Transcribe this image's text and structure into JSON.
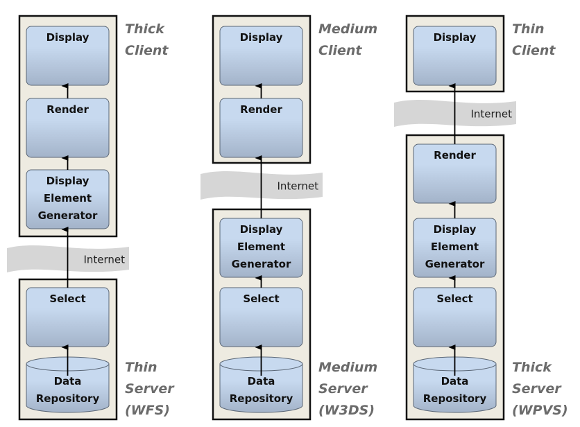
{
  "colors": {
    "tier_fill": "#eeebe1",
    "tier_stroke": "#111111",
    "component_top": "#c7d9ef",
    "component_bottom": "#a3b3c9",
    "network_band": "#d6d6d6",
    "label": "#6b6b6b"
  },
  "columns": [
    {
      "client_label": [
        "Thick",
        "Client"
      ],
      "server_label": [
        "Thin",
        "Server",
        "(WFS)"
      ],
      "client_components": [
        [
          "Display"
        ],
        [
          "Render"
        ],
        [
          "Display",
          "Element",
          "Generator"
        ]
      ],
      "server_components": [
        [
          "Select"
        ]
      ],
      "repository": [
        "Data",
        "Repository"
      ],
      "network_label": "Internet"
    },
    {
      "client_label": [
        "Medium",
        "Client"
      ],
      "server_label": [
        "Medium",
        "Server",
        "(W3DS)"
      ],
      "client_components": [
        [
          "Display"
        ],
        [
          "Render"
        ]
      ],
      "server_components": [
        [
          "Display",
          "Element",
          "Generator"
        ],
        [
          "Select"
        ]
      ],
      "repository": [
        "Data",
        "Repository"
      ],
      "network_label": "Internet"
    },
    {
      "client_label": [
        "Thin",
        "Client"
      ],
      "server_label": [
        "Thick",
        "Server",
        "(WPVS)"
      ],
      "client_components": [
        [
          "Display"
        ]
      ],
      "server_components": [
        [
          "Render"
        ],
        [
          "Display",
          "Element",
          "Generator"
        ],
        [
          "Select"
        ]
      ],
      "repository": [
        "Data",
        "Repository"
      ],
      "network_label": "Internet"
    }
  ]
}
